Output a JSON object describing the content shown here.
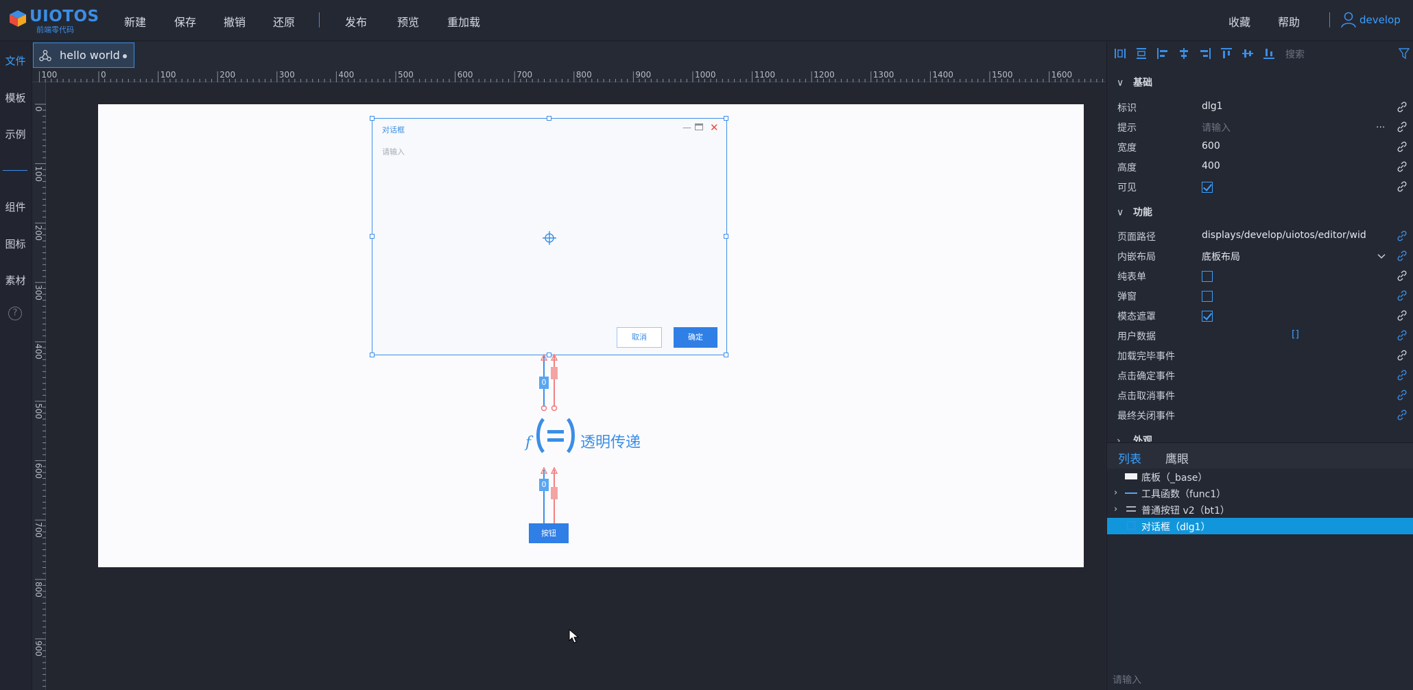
{
  "app": {
    "brand": "UIOTOS",
    "brand_sub": "前端零代码"
  },
  "topbar": {
    "menu": [
      "新建",
      "保存",
      "撤销",
      "还原",
      "发布",
      "预览",
      "重加载"
    ],
    "right": {
      "favorite": "收藏",
      "help": "帮助",
      "user": "develop"
    }
  },
  "leftbar": {
    "items_top": [
      "文件",
      "模板",
      "示例"
    ],
    "items_bottom": [
      "组件",
      "图标",
      "素材"
    ],
    "help": "?"
  },
  "tab": {
    "label": "hello world"
  },
  "hruler": [
    "100",
    "0",
    "100",
    "200",
    "300",
    "400",
    "500",
    "600",
    "700",
    "800",
    "900",
    "1000",
    "1100",
    "1200",
    "1300",
    "1400",
    "1500",
    "1600"
  ],
  "vruler": [
    "0",
    "100",
    "200",
    "300",
    "400",
    "500",
    "600",
    "700",
    "800",
    "900"
  ],
  "dialog": {
    "title": "对话框",
    "input_placeholder": "请输入",
    "cancel": "取消",
    "ok": "确定"
  },
  "func_node": {
    "symbol": "f",
    "label": "透明传递",
    "port_top": "0",
    "port_bottom": "0"
  },
  "canvas_button": {
    "label": "按钮"
  },
  "rightpanel": {
    "search_placeholder": "搜索",
    "sections": {
      "basic": "基础",
      "function": "功能",
      "appearance": "外观"
    },
    "basic": {
      "id_label": "标识",
      "id_value": "dlg1",
      "hint_label": "提示",
      "hint_placeholder": "请输入",
      "hint_more": "...",
      "width_label": "宽度",
      "width_value": "600",
      "height_label": "高度",
      "height_value": "400",
      "visible_label": "可见"
    },
    "function": {
      "path_label": "页面路径",
      "path_value": "displays/develop/uiotos/editor/widgets",
      "layout_label": "内嵌布局",
      "layout_value": "底板布局",
      "pure_form_label": "纯表单",
      "popup_label": "弹窗",
      "modal_label": "模态遮罩",
      "user_data_label": "用户数据",
      "user_data_value": "[]",
      "loaded_event_label": "加载完毕事件",
      "ok_event_label": "点击确定事件",
      "cancel_event_label": "点击取消事件",
      "close_event_label": "最终关闭事件"
    },
    "checks": {
      "visible": true,
      "pure_form": false,
      "popup": false,
      "modal": true
    }
  },
  "tree": {
    "tabs": [
      "列表",
      "鹰眼"
    ],
    "items": [
      {
        "label": "底板（_base）"
      },
      {
        "label": "工具函数（func1）"
      },
      {
        "label": "普通按钮 v2（bt1）"
      },
      {
        "label": "对话框（dlg1）"
      }
    ],
    "input_placeholder": "请输入"
  },
  "colors": {
    "accent": "#3a8ee6",
    "selected": "#1296db",
    "link_red": "#f08080"
  }
}
